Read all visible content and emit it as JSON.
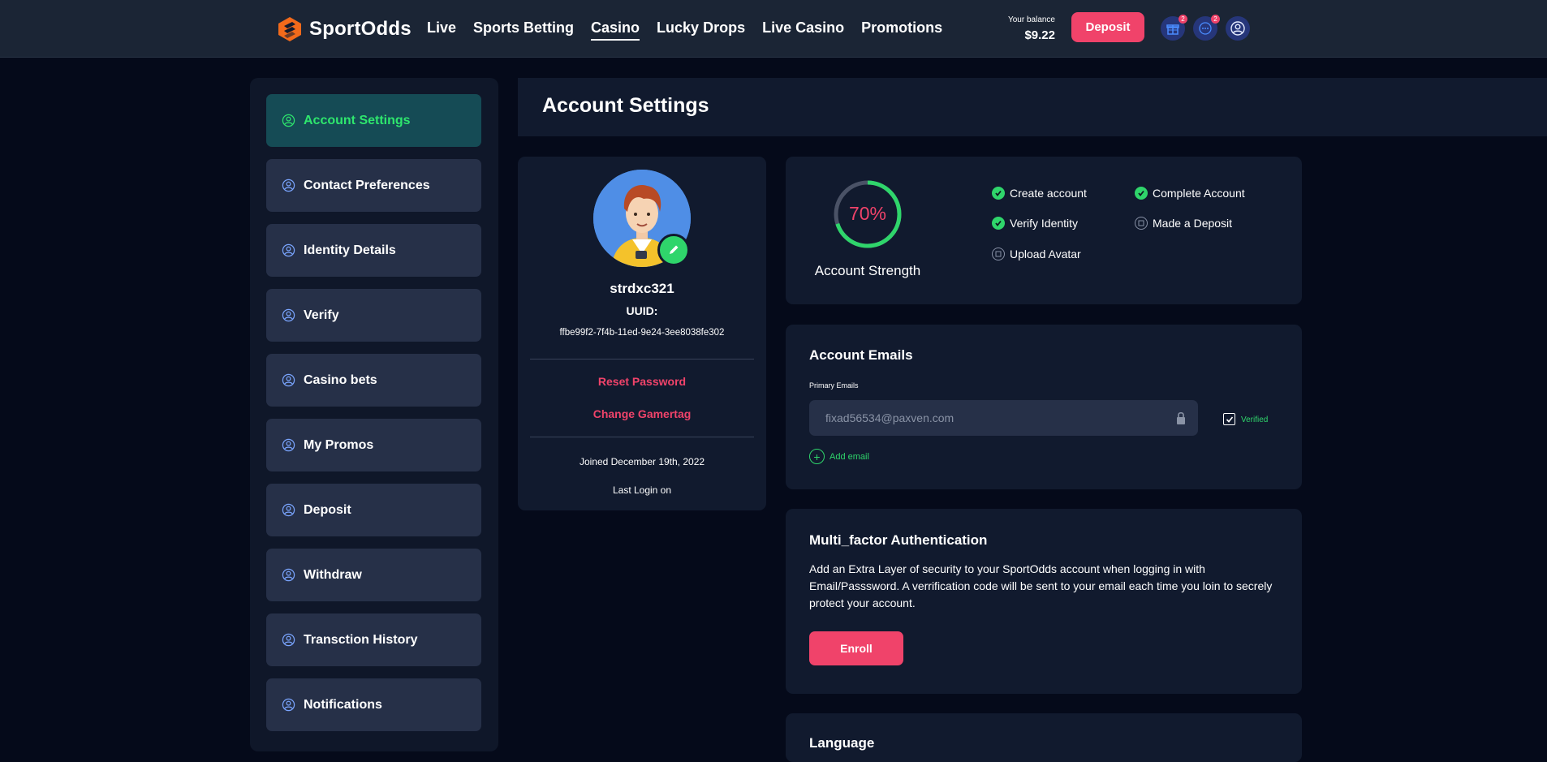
{
  "brand": {
    "name": "SportOdds"
  },
  "nav": {
    "items": [
      {
        "label": "Live"
      },
      {
        "label": "Sports Betting"
      },
      {
        "label": "Casino"
      },
      {
        "label": "Lucky Drops"
      },
      {
        "label": "Live Casino"
      },
      {
        "label": "Promotions"
      }
    ],
    "active": "Casino"
  },
  "header": {
    "balance_label": "Your balance",
    "balance_value": "$9.22",
    "deposit_label": "Deposit",
    "gift_badge": "2",
    "chat_badge": "2"
  },
  "sidebar": {
    "items": [
      {
        "label": "Account Settings"
      },
      {
        "label": "Contact Preferences"
      },
      {
        "label": "Identity Details"
      },
      {
        "label": "Verify"
      },
      {
        "label": "Casino bets"
      },
      {
        "label": "My Promos"
      },
      {
        "label": "Deposit"
      },
      {
        "label": "Withdraw"
      },
      {
        "label": "Transction History"
      },
      {
        "label": "Notifications"
      }
    ],
    "active": "Account Settings"
  },
  "page": {
    "title": "Account Settings"
  },
  "profile": {
    "username": "strdxc321",
    "uuid_label": "UUID:",
    "uuid_value": "ffbe99f2-7f4b-11ed-9e24-3ee8038fe302",
    "reset_password": "Reset Password",
    "change_gamertag": "Change Gamertag",
    "joined": "Joined December 19th, 2022",
    "last_login": "Last Login on"
  },
  "strength": {
    "percent_label": "70%",
    "percent": 70,
    "label": "Account Strength",
    "tasks": [
      {
        "label": "Create account",
        "done": true
      },
      {
        "label": "Complete Account",
        "done": true
      },
      {
        "label": "Verify Identity",
        "done": true
      },
      {
        "label": "Made a Deposit",
        "done": false
      },
      {
        "label": "Upload Avatar",
        "done": false
      }
    ]
  },
  "emails": {
    "title": "Account Emails",
    "primary_label": "Primary Emails",
    "primary_value": "fixad56534@paxven.com",
    "verified_label": "Verified",
    "add_email": "Add email"
  },
  "mfa": {
    "title": "Multi_factor Authentication",
    "description": "Add an Extra Layer of security to your SportOdds account when logging in with Email/Passsword. A verrification code will be sent to your email each time you loin to secrely protect your account.",
    "enroll_label": "Enroll"
  },
  "language": {
    "title": "Language"
  },
  "colors": {
    "accent_red": "#f0436a",
    "accent_green": "#2fd56b",
    "topbar_bg": "#1b2535",
    "card_bg": "#111a2e",
    "page_bg": "#050a1a"
  }
}
